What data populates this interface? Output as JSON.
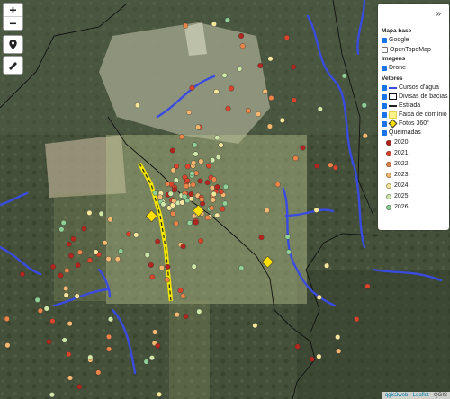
{
  "controls": {
    "zoom_in": "+",
    "zoom_out": "−",
    "locate_icon": "location-pin-icon",
    "measure_icon": "ruler-icon"
  },
  "panel": {
    "collapse": "»",
    "sections": {
      "base": "Mapa base",
      "imagery": "Imagens",
      "vectors": "Vetores"
    },
    "base_layers": [
      {
        "label": "Google",
        "checked": true
      },
      {
        "label": "OpenTopoMap",
        "checked": false
      }
    ],
    "imagery_layers": [
      {
        "label": "Drone",
        "checked": true
      }
    ],
    "vector_layers": [
      {
        "label": "Cursos d'água",
        "checked": true,
        "symbol": "blue-line"
      },
      {
        "label": "Divisas de bacias",
        "checked": true,
        "symbol": "black-outline"
      },
      {
        "label": "Estrada",
        "checked": true,
        "symbol": "dashed-line"
      },
      {
        "label": "Faixa de domínio",
        "checked": true,
        "symbol": "yellow-fill"
      },
      {
        "label": "Fotos 360°",
        "checked": true,
        "symbol": "yellow-diamond"
      },
      {
        "label": "Queimadas",
        "checked": true,
        "symbol": "none"
      }
    ],
    "years": [
      {
        "label": "2020",
        "color": "#b3261e"
      },
      {
        "label": "2021",
        "color": "#d9442a"
      },
      {
        "label": "2022",
        "color": "#ea8448"
      },
      {
        "label": "2023",
        "color": "#f4b971"
      },
      {
        "label": "2024",
        "color": "#f6e79c"
      },
      {
        "label": "2025",
        "color": "#cfe8a8"
      },
      {
        "label": "2026",
        "color": "#8fcf96"
      }
    ]
  },
  "attribution": {
    "qgis": "qgis2web",
    "sep": " · ",
    "leaflet": "Leaflet",
    "gis": " · QGIS"
  },
  "colors": {
    "water": "#3a4be0",
    "road": "#f3e600",
    "photo": "#fde000"
  }
}
